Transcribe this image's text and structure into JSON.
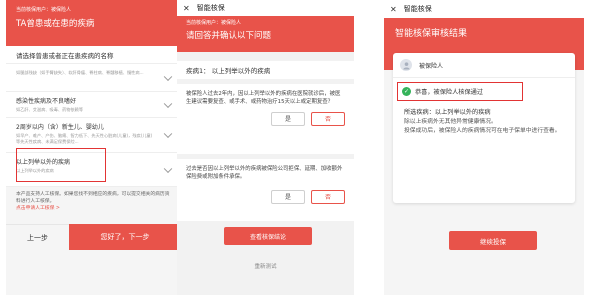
{
  "phone1": {
    "current_user": "当前核保用户：被保险人",
    "title": "TA曾患或在患的疾病",
    "section_title": "请选择曾患或者正在患疾病的名称",
    "items": [
      {
        "title": "",
        "desc": "如腿部残缺（如手臂缺失）、软肝骨瘤、脊柱病、脊髓移植、慢性病..."
      },
      {
        "title": "感染性疾病及不良嗜好",
        "desc": "如乙肝、艾滋病、吸毒、药物依赖等"
      },
      {
        "title": "2周岁以内（含）新生儿、婴幼儿",
        "desc": "如早产、难产、产伤、脑瘫、智力低下、先天性心脏病(儿童)，残疾(儿童)等先天性疾病、未满足保费保险..."
      },
      {
        "title": "以上列举以外的疾病",
        "desc": "以上列举以外的疾病"
      }
    ],
    "note_text": "本产品支持人工核保。如果您找不到相应的疾病，可以提交相关的病历资料进行人工核保。",
    "note_link": "点击申请人工核保 >",
    "prev_label": "上一步",
    "next_label": "您好了，下一步"
  },
  "phone2": {
    "nav_title": "智能核保",
    "close_icon": "✕",
    "current_user": "当前核保用户：被保险人",
    "title": "请回答并确认以下问题",
    "illness_label": "疾病1：   以上列举以外的疾病",
    "questions": [
      {
        "text": "被保险人过去2年内，因以上列举以外的疾病在医院就诊后，被医生建议需要复查、或手术、或药物治疗15天以上或定期复查？",
        "yes": "是",
        "no": "否"
      },
      {
        "text": "过去是否因以上列举以外的疾病被保险公司拒保、延期、加收额外保险费或附加条件承保。",
        "yes": "是",
        "no": "否"
      }
    ],
    "view_label": "查看核保结论",
    "retest_label": "重新测试"
  },
  "phone3": {
    "nav_title": "智能核保",
    "close_icon": "✕",
    "title": "智能核保审核结果",
    "insured_label": "被保险人",
    "result_text": "恭喜，被保险人核保通过",
    "detail_heading": "所选疾病：以上列举以外的疾病",
    "detail_lines": [
      "除以上疾病外无其他异常健康情况。",
      "投保成功后，被保险人的疾病情况可在电子保单中进行查看。"
    ],
    "continue_label": "继续投保"
  },
  "colors": {
    "accent": "#e8534a",
    "highlight_border": "#e23434",
    "success": "#34b35a"
  }
}
